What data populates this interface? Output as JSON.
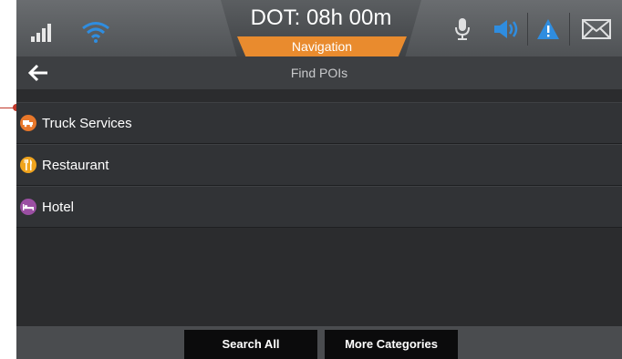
{
  "status": {
    "dot_label": "DOT: 08h 00m",
    "mode_label": "Navigation",
    "signal_icon": "signal-bars-icon",
    "wifi_icon": "wifi-icon",
    "mic_icon": "microphone-icon",
    "speaker_icon": "speaker-icon",
    "alert_icon": "warning-triangle-icon",
    "mail_icon": "mail-envelope-icon",
    "accent_blue": "#2f8de0",
    "accent_orange": "#e98b2e"
  },
  "header": {
    "title": "Find POIs",
    "back_icon": "back-arrow-icon"
  },
  "poi_list": [
    {
      "label": "Truck Services",
      "icon": "truck-icon",
      "color": "#e8772a"
    },
    {
      "label": "Restaurant",
      "icon": "fork-knife-icon",
      "color": "#f0a41e"
    },
    {
      "label": "Hotel",
      "icon": "bed-icon",
      "color": "#9b4fa3"
    }
  ],
  "footer": {
    "search_all_label": "Search All",
    "more_categories_label": "More Categories"
  }
}
